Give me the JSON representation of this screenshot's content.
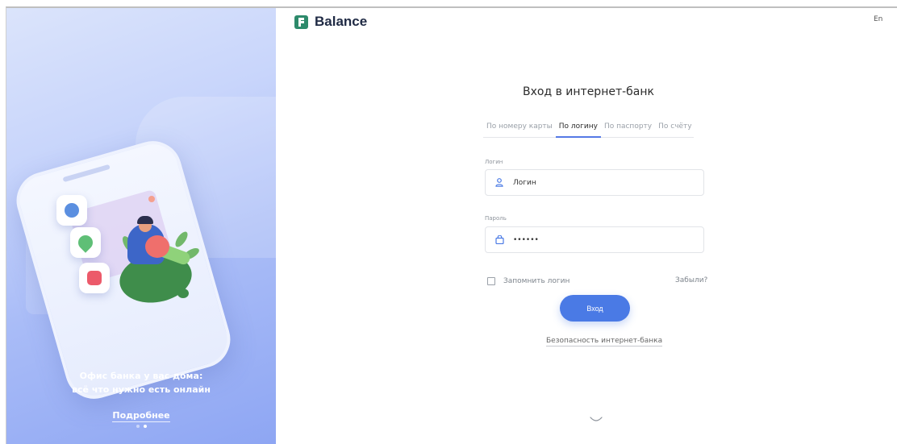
{
  "brand": {
    "name": "Balance"
  },
  "header": {
    "language": "En"
  },
  "promo": {
    "line1": "Офис банка у вас дома:",
    "line2": "всё что нужно есть онлайн",
    "more": "Подробнее",
    "slides_total": 2,
    "slide_active": 2
  },
  "login": {
    "title": "Вход в интернет-банк",
    "tabs": [
      {
        "label": "По номеру карты",
        "active": false
      },
      {
        "label": "По логину",
        "active": true
      },
      {
        "label": "По паспорту",
        "active": false
      },
      {
        "label": "По счёту",
        "active": false
      }
    ],
    "login_label": "Логин",
    "login_placeholder": "Логин",
    "password_label": "Пароль",
    "password_value": "••••••",
    "remember_label": "Запомнить логин",
    "remember_checked": false,
    "forgot": "Забыли?",
    "submit": "Вход",
    "security_link": "Безопасность интернет-банка"
  },
  "colors": {
    "accent": "#4a7ae5",
    "brand": "#2d8a6b"
  }
}
